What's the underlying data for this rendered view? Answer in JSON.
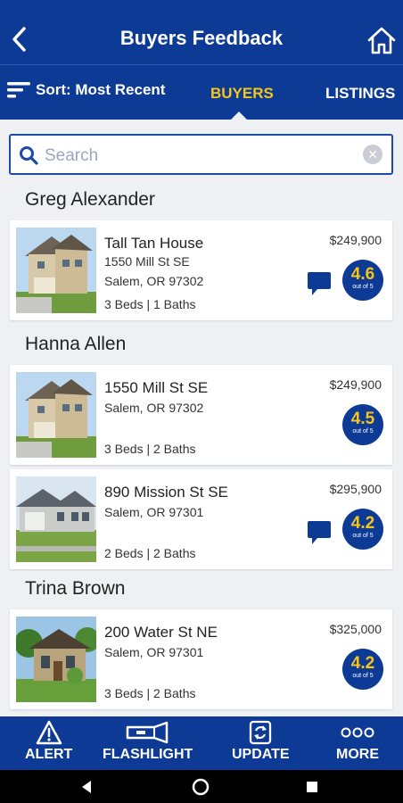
{
  "header": {
    "title": "Buyers Feedback"
  },
  "subbar": {
    "sort_label": "Sort: Most Recent",
    "tabs": [
      {
        "label": "BUYERS",
        "active": true
      },
      {
        "label": "LISTINGS",
        "active": false
      }
    ]
  },
  "search": {
    "placeholder": "Search"
  },
  "buyers": [
    {
      "name": "Greg Alexander",
      "listings": [
        {
          "title": "Tall Tan House",
          "street": "1550 Mill St SE",
          "city": "Salem, OR 97302",
          "beds_baths": "3 Beds | 1 Baths",
          "price": "$249,900",
          "rating": "4.6",
          "rating_out": "out of 5",
          "has_comment": true
        }
      ]
    },
    {
      "name": "Hanna Allen",
      "listings": [
        {
          "street": "1550 Mill St SE",
          "city": "Salem, OR 97302",
          "beds_baths": "3 Beds | 2 Baths",
          "price": "$249,900",
          "rating": "4.5",
          "rating_out": "out of 5",
          "has_comment": false
        },
        {
          "street": "890 Mission St SE",
          "city": "Salem, OR 97301",
          "beds_baths": "2 Beds | 2 Baths",
          "price": "$295,900",
          "rating": "4.2",
          "rating_out": "out of 5",
          "has_comment": true
        }
      ]
    },
    {
      "name": "Trina Brown",
      "listings": [
        {
          "street": "200 Water St NE",
          "city": "Salem, OR 97301",
          "beds_baths": "3 Beds | 2 Baths",
          "price": "$325,000",
          "rating": "4.2",
          "rating_out": "out of 5",
          "has_comment": false
        }
      ]
    }
  ],
  "bottom_nav": [
    {
      "label": "ALERT",
      "icon": "alert-icon"
    },
    {
      "label": "FLASHLIGHT",
      "icon": "flashlight-icon"
    },
    {
      "label": "UPDATE",
      "icon": "update-icon"
    },
    {
      "label": "MORE",
      "icon": "more-icon"
    }
  ],
  "colors": {
    "brand": "#0d3a95",
    "accent": "#f5c518"
  }
}
